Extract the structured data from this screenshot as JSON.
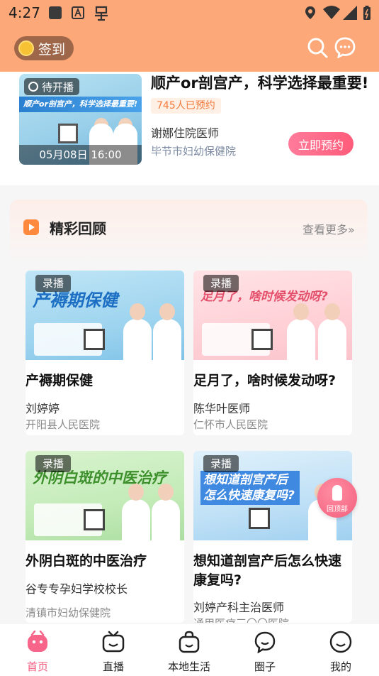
{
  "status_bar": {
    "time": "4:27"
  },
  "appbar": {
    "signin_label": "签到"
  },
  "live": {
    "badge": "待开播",
    "thumb_banner": "顺产or剖宫产，科学选择最重要!",
    "time": "05月08日 16:00",
    "title": "顺产or剖宫产，科学选择最重要!",
    "booked": "745人已预约",
    "doctor": "谢娜住院医师",
    "hospital": "毕节市妇幼保健院",
    "book_button": "立即预约"
  },
  "highlights": {
    "title": "精彩回顾",
    "more": "查看更多»",
    "cards": [
      {
        "badge": "录播",
        "banner": "产褥期保健",
        "title": "产褥期保健",
        "doctor": "刘婷婷",
        "hospital": "开阳县人民医院"
      },
      {
        "badge": "录播",
        "banner": "足月了，啥时候发动呀?",
        "title": "足月了，啥时候发动呀?",
        "doctor": "陈华叶医师",
        "hospital": "仁怀市人民医院"
      },
      {
        "badge": "录播",
        "banner": "外阴白斑的中医治疗",
        "title": "外阴白斑的中医治疗",
        "doctor": "谷专专孕妇学校校长",
        "hospital": "清镇市妇幼保健院"
      },
      {
        "badge": "录播",
        "banner": "想知道剖宫产后怎么快速康复吗?",
        "title": "想知道剖宫产后怎么快速康复吗?",
        "doctor": "刘婷产科主治医师",
        "hospital": "通用医疗三〇〇医院"
      }
    ]
  },
  "float_button": {
    "label": "回顶部"
  },
  "tabbar": {
    "tabs": [
      {
        "label": "首页",
        "icon": "home-icon"
      },
      {
        "label": "直播",
        "icon": "tv-icon"
      },
      {
        "label": "本地生活",
        "icon": "bag-icon"
      },
      {
        "label": "圈子",
        "icon": "chat-icon"
      },
      {
        "label": "我的",
        "icon": "smile-icon"
      }
    ]
  },
  "colors": {
    "header": "#fda879",
    "accent": "#f25a7e",
    "booked_text": "#f07a3a"
  }
}
